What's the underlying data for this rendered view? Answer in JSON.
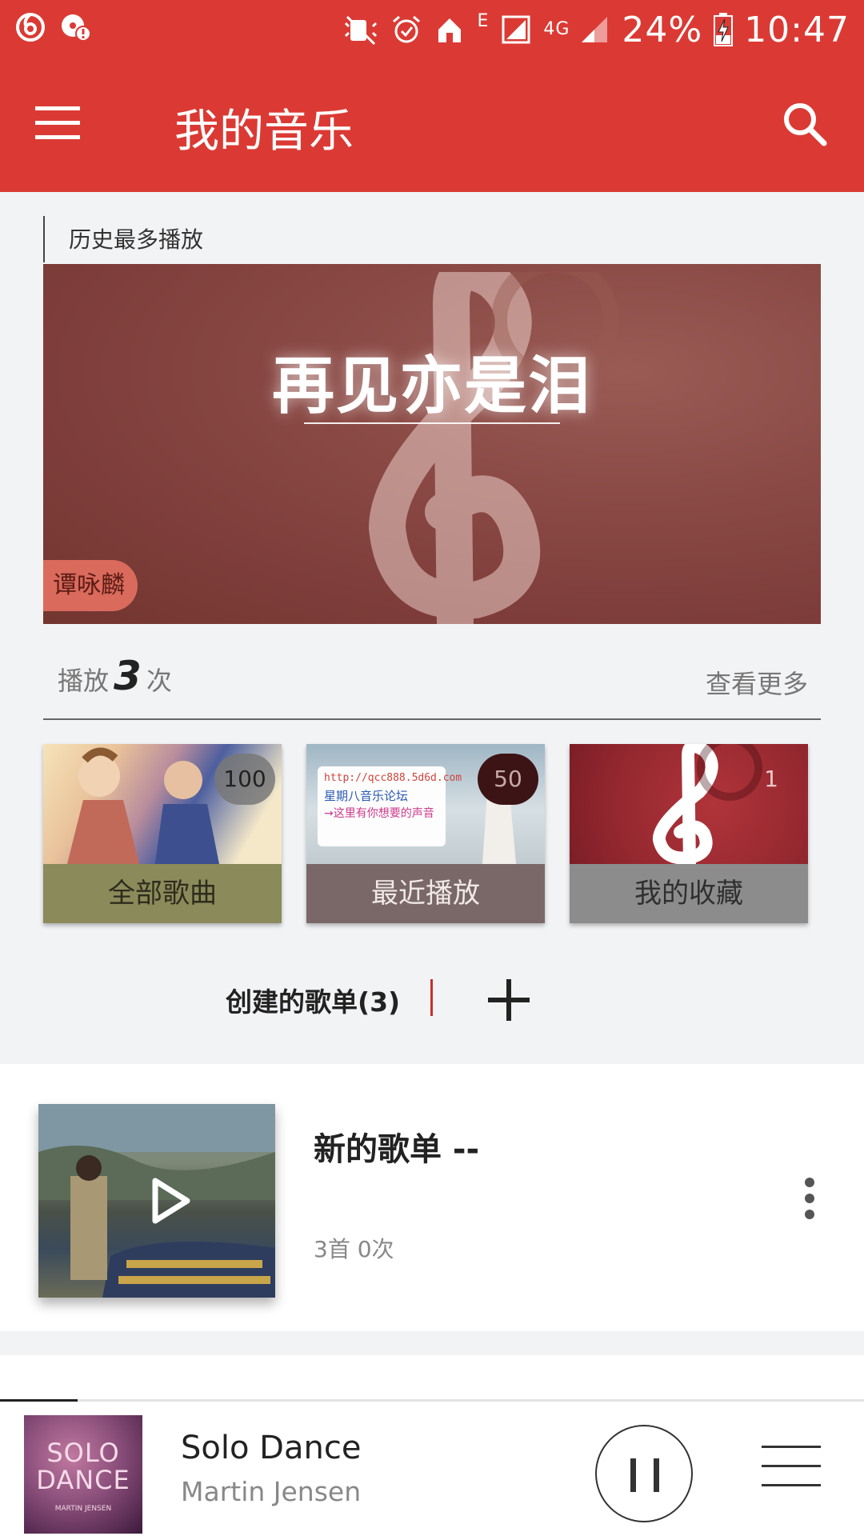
{
  "status_bar": {
    "network": "4G",
    "signal_e": "E",
    "battery": "24%",
    "time": "10:47"
  },
  "toolbar": {
    "title": "我的音乐"
  },
  "history": {
    "label": "历史最多播放",
    "song_title": "再见亦是泪",
    "artist": "谭咏麟",
    "play_prefix": "播放",
    "play_count": "3",
    "play_suffix": "次",
    "more_label": "查看更多"
  },
  "cards": [
    {
      "label": "全部歌曲",
      "count": "100"
    },
    {
      "label": "最近播放",
      "count": "50"
    },
    {
      "label": "我的收藏",
      "count": "1"
    }
  ],
  "card_art": {
    "sign_line1": "http://qcc888.5d6d.com",
    "sign_line2": "星期八音乐论坛",
    "sign_line3": "→这里有你想要的声音"
  },
  "created": {
    "label": "创建的歌单(3)"
  },
  "playlist": {
    "name": "新的歌单 --",
    "meta": "3首  0次"
  },
  "player": {
    "title": "Solo Dance",
    "artist": "Martin Jensen",
    "cover_text": "SOLO DANCE",
    "cover_sub": "MARTIN  JENSEN",
    "progress": 0.09
  },
  "colors": {
    "brand_red": "#db3a34",
    "background": "#f2f3f5"
  },
  "icons": [
    "netease-music-icon",
    "notification-icon",
    "mute-icon",
    "alarm-icon",
    "home-icon",
    "sim-icon",
    "signal-icon",
    "battery-icon",
    "menu-icon",
    "search-icon",
    "plus-icon",
    "play-icon",
    "more-vertical-icon",
    "pause-icon",
    "queue-icon"
  ]
}
